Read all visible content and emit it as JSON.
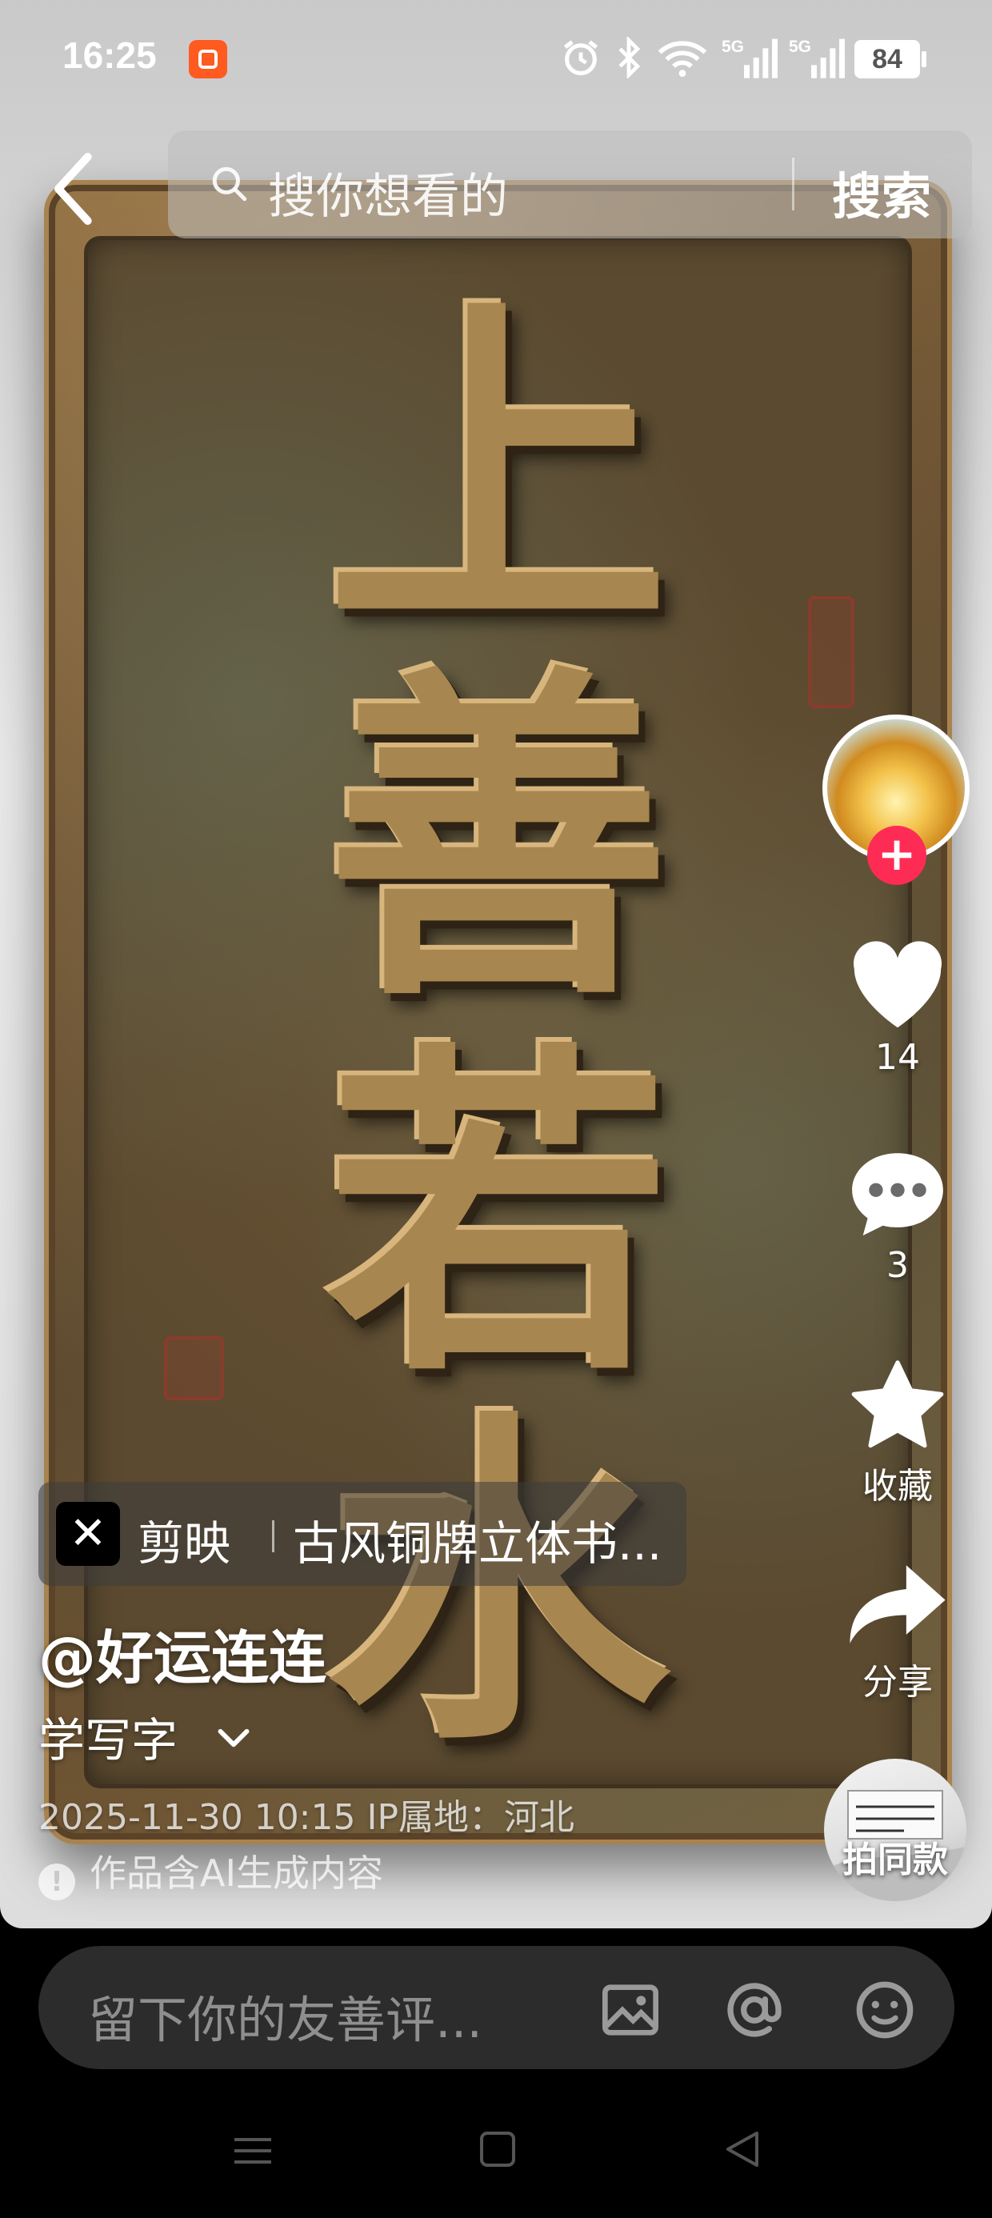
{
  "status_bar": {
    "time": "16:25",
    "battery": "84",
    "icons": [
      "alarm-icon",
      "bluetooth-icon",
      "wifi-icon",
      "signal-5g-icon",
      "signal-5g-icon"
    ]
  },
  "search": {
    "placeholder": "搜你想看的",
    "button_label": "搜索"
  },
  "video": {
    "plaque_text": [
      "上",
      "善",
      "若",
      "水"
    ]
  },
  "actions": {
    "like_count": "14",
    "comment_count": "3",
    "favorite_label": "收藏",
    "share_label": "分享",
    "same_style_label": "拍同款"
  },
  "info": {
    "template_app": "剪映",
    "template_title": "古风铜牌立体书...",
    "author": "@好运连连",
    "description": "学写字",
    "meta": "2025-11-30 10:15  IP属地：河北",
    "ai_note": "作品含AI生成内容"
  },
  "comment_bar": {
    "placeholder": "留下你的友善评..."
  },
  "colors": {
    "follow_accent": "#fe2c55",
    "capcut_bg": "#000000",
    "app_badge": "#ff5a1f"
  }
}
